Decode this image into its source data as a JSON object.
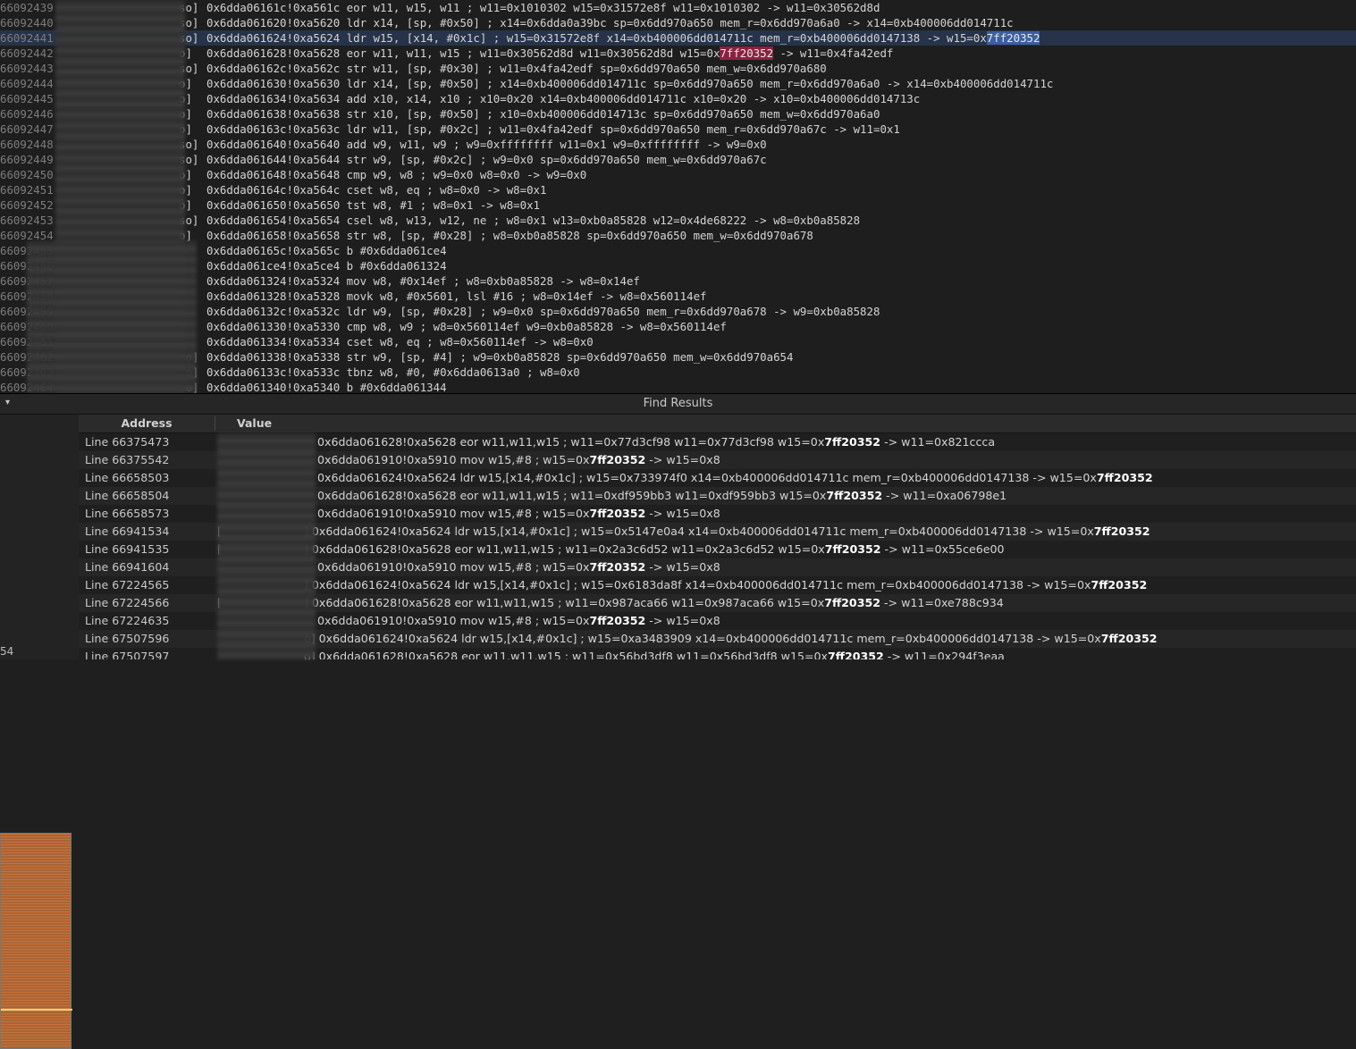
{
  "editor": {
    "lines": [
      {
        "num": "66092439",
        "prefix": "so]",
        "code": "0x6dda06161c!0xa561c eor w11, w15, w11 ; w11=0x1010302 w15=0x31572e8f w11=0x1010302 -> w11=0x30562d8d"
      },
      {
        "num": "66092440",
        "prefix": "so]",
        "code": "0x6dda061620!0xa5620 ldr x14, [sp, #0x50] ; x14=0x6dda0a39bc sp=0x6dd970a650 mem_r=0x6dd970a6a0 -> x14=0xb400006dd014711c"
      },
      {
        "num": "66092441",
        "prefix": "so]",
        "code": "0x6dda061624!0xa5624 ldr w15, [x14, #0x1c] ; w15=0x31572e8f x14=0xb400006dd014711c mem_r=0xb400006dd0147138 -> w15=0x",
        "hl": "7ff20352",
        "hlType": "sel",
        "selected": true
      },
      {
        "num": "66092442",
        "prefix": "o]",
        "code": "0x6dda061628!0xa5628 eor w11, w11, w15 ; w11=0x30562d8d w11=0x30562d8d w15=0x",
        "hl": "7ff20352",
        "tail": " -> w11=0x4fa42edf",
        "hlType": "red"
      },
      {
        "num": "66092443",
        "prefix": "so]",
        "code": "0x6dda06162c!0xa562c str w11, [sp, #0x30] ; w11=0x4fa42edf sp=0x6dd970a650 mem_w=0x6dd970a680"
      },
      {
        "num": "66092444",
        "prefix": "o]",
        "code": "0x6dda061630!0xa5630 ldr x14, [sp, #0x50] ; x14=0xb400006dd014711c sp=0x6dd970a650 mem_r=0x6dd970a6a0 -> x14=0xb400006dd014711c"
      },
      {
        "num": "66092445",
        "prefix": "o]",
        "code": "0x6dda061634!0xa5634 add x10, x14, x10 ; x10=0x20 x14=0xb400006dd014711c x10=0x20 -> x10=0xb400006dd014713c"
      },
      {
        "num": "66092446",
        "prefix": "o]",
        "code": "0x6dda061638!0xa5638 str x10, [sp, #0x50] ; x10=0xb400006dd014713c sp=0x6dd970a650 mem_w=0x6dd970a6a0"
      },
      {
        "num": "66092447",
        "prefix": "o]",
        "code": "0x6dda06163c!0xa563c ldr w11, [sp, #0x2c] ; w11=0x4fa42edf sp=0x6dd970a650 mem_r=0x6dd970a67c -> w11=0x1"
      },
      {
        "num": "66092448",
        "prefix": "so]",
        "code": "0x6dda061640!0xa5640 add w9, w11, w9 ; w9=0xffffffff w11=0x1 w9=0xffffffff -> w9=0x0"
      },
      {
        "num": "66092449",
        "prefix": "so]",
        "code": "0x6dda061644!0xa5644 str w9, [sp, #0x2c] ; w9=0x0 sp=0x6dd970a650 mem_w=0x6dd970a67c"
      },
      {
        "num": "66092450",
        "prefix": "o]",
        "code": "0x6dda061648!0xa5648 cmp w9, w8 ; w9=0x0 w8=0x0 -> w9=0x0"
      },
      {
        "num": "66092451",
        "prefix": "o]",
        "code": "0x6dda06164c!0xa564c cset w8, eq ; w8=0x0 -> w8=0x1"
      },
      {
        "num": "66092452",
        "prefix": "o]",
        "code": "0x6dda061650!0xa5650 tst w8, #1 ; w8=0x1 -> w8=0x1"
      },
      {
        "num": "66092453",
        "prefix": "so]",
        "code": "0x6dda061654!0xa5654 csel w8, w13, w12, ne ; w8=0x1 w13=0xb0a85828 w12=0x4de68222 -> w8=0xb0a85828"
      },
      {
        "num": "66092454",
        "prefix": "o]",
        "code": "0x6dda061658!0xa5658 str w8, [sp, #0x28] ; w8=0xb0a85828 sp=0x6dd970a650 mem_w=0x6dd970a678"
      },
      {
        "num": "66092455",
        "prefix": "",
        "code": "0x6dda06165c!0xa565c b #0x6dda061ce4"
      },
      {
        "num": "66092456",
        "prefix": "",
        "code": "0x6dda061ce4!0xa5ce4 b #0x6dda061324"
      },
      {
        "num": "66092457",
        "prefix": "",
        "code": "0x6dda061324!0xa5324 mov w8, #0x14ef ; w8=0xb0a85828 -> w8=0x14ef"
      },
      {
        "num": "66092458",
        "prefix": "",
        "code": "0x6dda061328!0xa5328 movk w8, #0x5601, lsl #16 ; w8=0x14ef -> w8=0x560114ef"
      },
      {
        "num": "66092459",
        "prefix": "",
        "code": "0x6dda06132c!0xa532c ldr w9, [sp, #0x28] ; w9=0x0 sp=0x6dd970a650 mem_r=0x6dd970a678 -> w9=0xb0a85828"
      },
      {
        "num": "66092460",
        "prefix": "]",
        "code": "0x6dda061330!0xa5330 cmp w8, w9 ; w8=0x560114ef w9=0xb0a85828 -> w8=0x560114ef"
      },
      {
        "num": "66092461",
        "prefix": "]",
        "code": "0x6dda061334!0xa5334 cset w8, eq ; w8=0x560114ef -> w8=0x0"
      },
      {
        "num": "66092462",
        "prefix": "so]",
        "code": "0x6dda061338!0xa5338 str w9, [sp, #4] ; w9=0xb0a85828 sp=0x6dd970a650 mem_w=0x6dd970a654"
      },
      {
        "num": "66092463",
        "prefix": "so]",
        "code": "0x6dda06133c!0xa533c tbnz w8, #0, #0x6dda0613a0 ; w8=0x0"
      },
      {
        "num": "66092464",
        "prefix": "so]",
        "code": "0x6dda061340!0xa5340 b #0x6dda061344"
      }
    ]
  },
  "find_panel": {
    "title": "Find Results",
    "caret": "▾",
    "left_counter": "54",
    "columns": {
      "address": "Address",
      "value": "Value"
    },
    "rows": [
      {
        "address": "Line 66375473",
        "pre": "",
        "value": "0x6dda061628!0xa5628 eor w11,w11,w15 ; w11=0x77d3cf98 w11=0x77d3cf98 w15=0x",
        "bold": "7ff20352",
        "tail": " -> w11=0x821ccca"
      },
      {
        "address": "Line 66375542",
        "pre": "",
        "value": "0x6dda061910!0xa5910 mov w15,#8 ; w15=0x",
        "bold": "7ff20352",
        "tail": " -> w15=0x8"
      },
      {
        "address": "Line 66658503",
        "pre": "",
        "value": "0x6dda061624!0xa5624 ldr w15,[x14,#0x1c] ; w15=0x733974f0 x14=0xb400006dd014711c mem_r=0xb400006dd0147138 -> w15=0x",
        "bold": "7ff20352",
        "tail": ""
      },
      {
        "address": "Line 66658504",
        "pre": "",
        "value": "0x6dda061628!0xa5628 eor w11,w11,w15 ; w11=0xdf959bb3 w11=0xdf959bb3 w15=0x",
        "bold": "7ff20352",
        "tail": " -> w11=0xa06798e1"
      },
      {
        "address": "Line 66658573",
        "pre": "",
        "value": "0x6dda061910!0xa5910 mov w15,#8 ; w15=0x",
        "bold": "7ff20352",
        "tail": " -> w15=0x8"
      },
      {
        "address": "Line 66941534",
        "pre": "[",
        "value": "] 0x6dda061624!0xa5624 ldr w15,[x14,#0x1c] ; w15=0x5147e0a4 x14=0xb400006dd014711c mem_r=0xb400006dd0147138 -> w15=0x",
        "bold": "7ff20352",
        "tail": ""
      },
      {
        "address": "Line 66941535",
        "pre": "[",
        "value": "] 0x6dda061628!0xa5628 eor w11,w11,w15 ; w11=0x2a3c6d52 w11=0x2a3c6d52 w15=0x",
        "bold": "7ff20352",
        "tail": " -> w11=0x55ce6e00"
      },
      {
        "address": "Line 66941604",
        "pre": "",
        "value": "0x6dda061910!0xa5910 mov w15,#8 ; w15=0x",
        "bold": "7ff20352",
        "tail": " -> w15=0x8"
      },
      {
        "address": "Line 67224565",
        "pre": "",
        "value": "] 0x6dda061624!0xa5624 ldr w15,[x14,#0x1c] ; w15=0x6183da8f x14=0xb400006dd014711c mem_r=0xb400006dd0147138 -> w15=0x",
        "bold": "7ff20352",
        "tail": ""
      },
      {
        "address": "Line 67224566",
        "pre": "[",
        "value": "] 0x6dda061628!0xa5628 eor w11,w11,w15 ; w11=0x987aca66 w11=0x987aca66 w15=0x",
        "bold": "7ff20352",
        "tail": " -> w11=0xe788c934"
      },
      {
        "address": "Line 67224635",
        "pre": "",
        "value": "0x6dda061910!0xa5910 mov w15,#8 ; w15=0x",
        "bold": "7ff20352",
        "tail": " -> w15=0x8"
      },
      {
        "address": "Line 67507596",
        "pre": "",
        "value": "o] 0x6dda061624!0xa5624 ldr w15,[x14,#0x1c] ; w15=0xa3483909 x14=0xb400006dd014711c mem_r=0xb400006dd0147138 -> w15=0x",
        "bold": "7ff20352",
        "tail": ""
      },
      {
        "address": "Line 67507597",
        "pre": "",
        "value": "o] 0x6dda061628!0xa5628 eor w11,w11,w15 ; w11=0x56bd3df8 w11=0x56bd3df8 w15=0x",
        "bold": "7ff20352",
        "tail": " -> w11=0x294f3eaa"
      }
    ]
  },
  "colors": {
    "selected_line_bg": "#26334a",
    "match_highlight_red": "#8b2140",
    "match_highlight_blue": "#3d5ea0",
    "minimap_orange": "#c8723a"
  }
}
